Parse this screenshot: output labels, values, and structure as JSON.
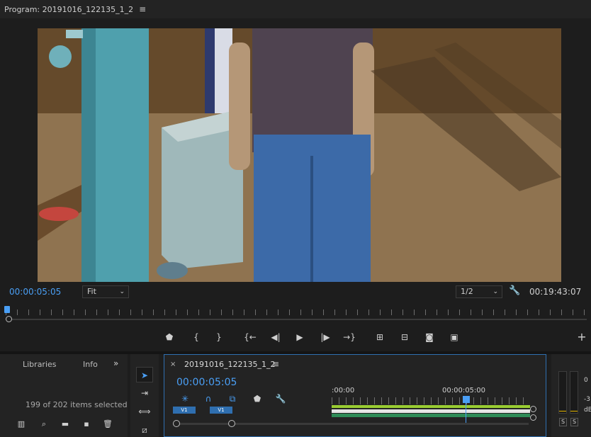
{
  "program_monitor": {
    "title": "Program: 20191016_122135_1_2",
    "menu_icon": "hamburger-menu-icon",
    "current_timecode": "00:00:05:05",
    "fit_select": "Fit",
    "resolution_select": "1/2",
    "duration_timecode": "00:19:43:07"
  },
  "transport": {
    "icons": [
      "add-marker-icon",
      "mark-in-icon",
      "mark-out-icon",
      "go-to-in-icon",
      "step-back-icon",
      "play-icon",
      "step-forward-icon",
      "go-to-out-icon",
      "lift-icon",
      "extract-icon",
      "export-frame-icon",
      "compare-view-icon",
      "add-button-icon"
    ]
  },
  "left_panel": {
    "tabs": [
      "Libraries",
      "Info"
    ],
    "more": "»",
    "items_selected": "199 of 202 items selected"
  },
  "timeline": {
    "close": "×",
    "sequence_name": "20191016_122135_1_2",
    "menu": "≡",
    "timecode": "00:00:05:05",
    "ruler_start": ":00:00",
    "ruler_mark": "00:00:05:00",
    "track_v1": "V1",
    "track_v1_target": "V1"
  },
  "audio_meter": {
    "scale": [
      "0",
      "-3",
      "dB"
    ],
    "solo_left": "S",
    "solo_right": "S"
  },
  "colors": {
    "accent": "#4a9ff5",
    "panel_bg": "#232323",
    "green_bar": "#9acd32"
  }
}
